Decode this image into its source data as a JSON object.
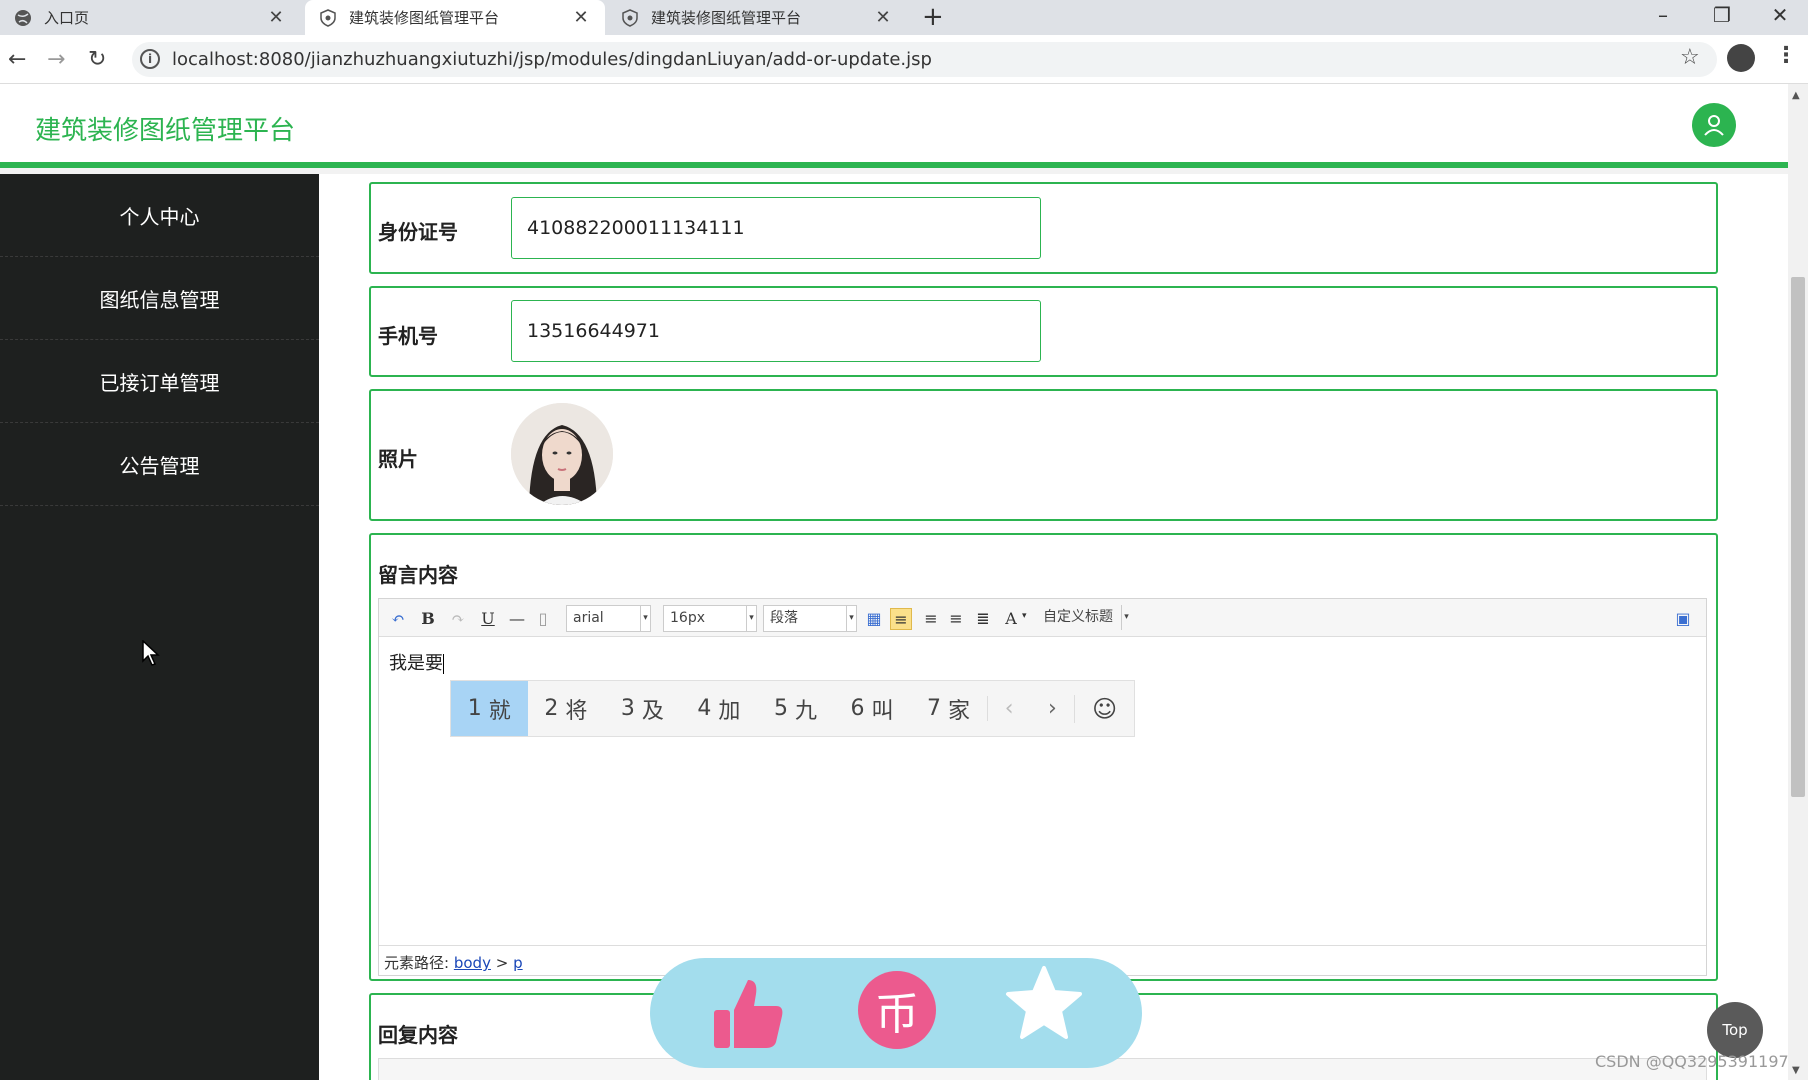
{
  "browser": {
    "tabs": [
      {
        "label": "入口页"
      },
      {
        "label": "建筑装修图纸管理平台"
      },
      {
        "label": "建筑装修图纸管理平台"
      }
    ],
    "url": "localhost:8080/jianzhuzhuangxiutuzhi/jsp/modules/dingdanLiuyan/add-or-update.jsp"
  },
  "app": {
    "title": "建筑装修图纸管理平台"
  },
  "sidebar": {
    "items": [
      {
        "label": "个人中心"
      },
      {
        "label": "图纸信息管理"
      },
      {
        "label": "已接订单管理"
      },
      {
        "label": "公告管理"
      }
    ]
  },
  "form": {
    "id_card": {
      "label": "身份证号",
      "value": "410882200011134111"
    },
    "phone": {
      "label": "手机号",
      "value": "13516644971"
    },
    "photo": {
      "label": "照片"
    },
    "message": {
      "label": "留言内容",
      "content": "我是要",
      "toolbar": {
        "font": "arial",
        "size": "16px",
        "paragraph": "段落",
        "custom_title": "自定义标题"
      },
      "path_label": "元素路径:",
      "path_body": "body",
      "path_sep": ">",
      "path_p": "p"
    },
    "reply": {
      "label": "回复内容"
    }
  },
  "ime": {
    "candidates": [
      {
        "num": "1",
        "text": "就"
      },
      {
        "num": "2",
        "text": "将"
      },
      {
        "num": "3",
        "text": "及"
      },
      {
        "num": "4",
        "text": "加"
      },
      {
        "num": "5",
        "text": "九"
      },
      {
        "num": "6",
        "text": "叫"
      },
      {
        "num": "7",
        "text": "家"
      }
    ]
  },
  "floating": {
    "coin_glyph": "币"
  },
  "top_button": "Top",
  "watermark": "CSDN @QQ3295391197_",
  "colors": {
    "accent": "#2cb450",
    "sidebar_bg": "#1e201f",
    "fab_bg": "#a3dded",
    "fab_pink": "#ec5a8e"
  }
}
